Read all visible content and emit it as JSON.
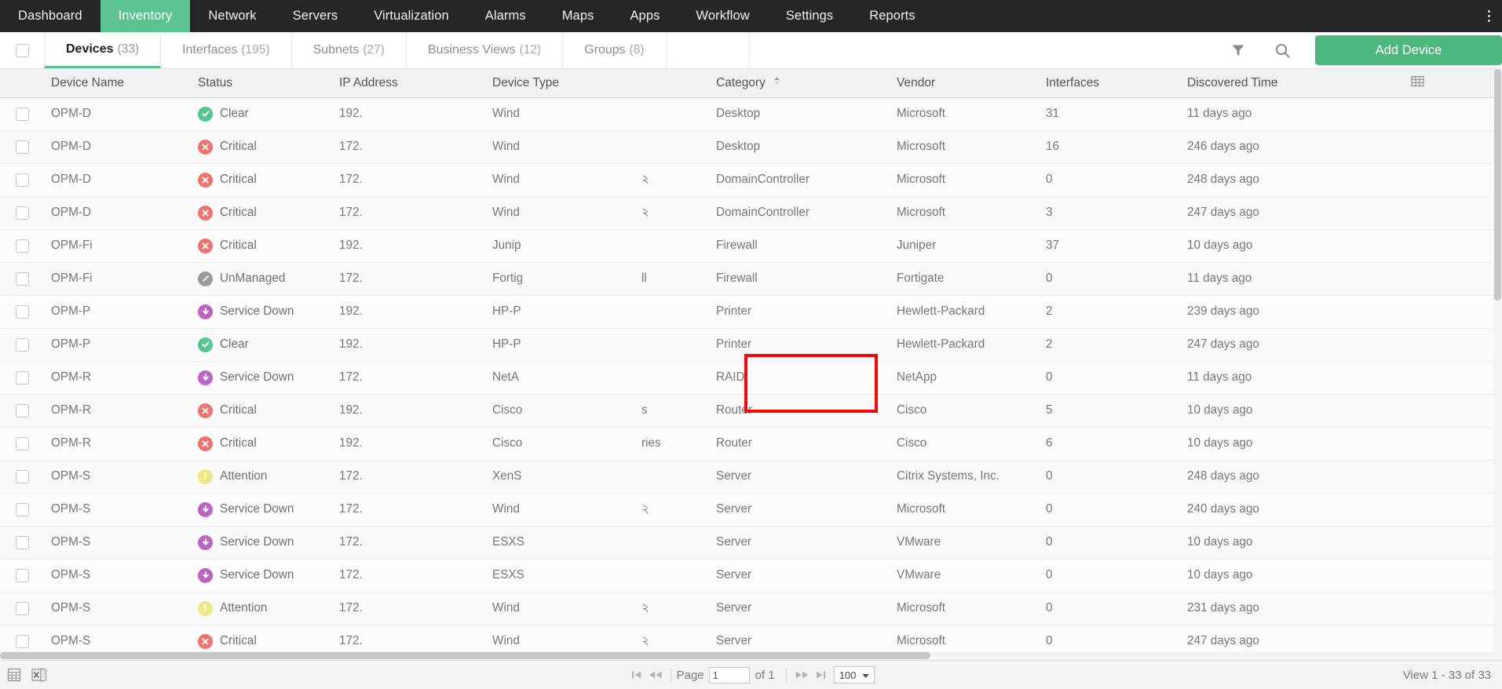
{
  "topnav": {
    "items": [
      {
        "label": "Dashboard",
        "active": false
      },
      {
        "label": "Inventory",
        "active": true
      },
      {
        "label": "Network",
        "active": false
      },
      {
        "label": "Servers",
        "active": false
      },
      {
        "label": "Virtualization",
        "active": false
      },
      {
        "label": "Alarms",
        "active": false
      },
      {
        "label": "Maps",
        "active": false
      },
      {
        "label": "Apps",
        "active": false
      },
      {
        "label": "Workflow",
        "active": false
      },
      {
        "label": "Settings",
        "active": false
      },
      {
        "label": "Reports",
        "active": false
      }
    ],
    "accent_active": "#5ac38f",
    "background": "#262626"
  },
  "tabbar": {
    "tabs": [
      {
        "label": "Devices",
        "count": "(33)",
        "active": true
      },
      {
        "label": "Interfaces",
        "count": "(195)",
        "active": false
      },
      {
        "label": "Subnets",
        "count": "(27)",
        "active": false
      },
      {
        "label": "Business Views",
        "count": "(12)",
        "active": false
      },
      {
        "label": "Groups",
        "count": "(8)",
        "active": false
      }
    ],
    "filter_icon": "filter-icon",
    "search_icon": "search-icon",
    "add_device_label": "Add Device",
    "add_device_color": "#4cb87e"
  },
  "table": {
    "columns": [
      {
        "key": "name",
        "label": "Device Name",
        "sorted": false
      },
      {
        "key": "stat",
        "label": "Status",
        "sorted": false
      },
      {
        "key": "ip",
        "label": "IP Address",
        "sorted": false
      },
      {
        "key": "type",
        "label": "Device Type",
        "sorted": false
      },
      {
        "key": "cat",
        "label": "Category",
        "sorted": true,
        "sort_dir": "asc"
      },
      {
        "key": "vend",
        "label": "Vendor",
        "sorted": false
      },
      {
        "key": "intf",
        "label": "Interfaces",
        "sorted": false
      },
      {
        "key": "disc",
        "label": "Discovered Time",
        "sorted": false
      }
    ],
    "column_chooser_icon": "grid-columns-icon",
    "rows": [
      {
        "name": "OPM-D",
        "status": "Clear",
        "status_icon": "clear-icon",
        "ip": "192.",
        "type": "Wind",
        "type2": "",
        "category": "Desktop",
        "vendor": "Microsoft",
        "interfaces": "31",
        "discovered": "11 days ago"
      },
      {
        "name": "OPM-D",
        "status": "Critical",
        "status_icon": "critical-icon",
        "ip": "172.",
        "type": "Wind",
        "type2": "",
        "category": "Desktop",
        "vendor": "Microsoft",
        "interfaces": "16",
        "discovered": "246 days ago"
      },
      {
        "name": "OPM-D",
        "status": "Critical",
        "status_icon": "critical-icon",
        "ip": "172.",
        "type": "Wind",
        "type2": "২",
        "category": "DomainController",
        "vendor": "Microsoft",
        "interfaces": "0",
        "discovered": "248 days ago"
      },
      {
        "name": "OPM-D",
        "status": "Critical",
        "status_icon": "critical-icon",
        "ip": "172.",
        "type": "Wind",
        "type2": "২",
        "category": "DomainController",
        "vendor": "Microsoft",
        "interfaces": "3",
        "discovered": "247 days ago"
      },
      {
        "name": "OPM-Fi",
        "status": "Critical",
        "status_icon": "critical-icon",
        "ip": "192.",
        "type": "Junip",
        "type2": "",
        "category": "Firewall",
        "vendor": "Juniper",
        "interfaces": "37",
        "discovered": "10 days ago"
      },
      {
        "name": "OPM-Fi",
        "status": "UnManaged",
        "status_icon": "unmanaged-icon",
        "ip": "172.",
        "type": "Fortig",
        "type2": "ll",
        "category": "Firewall",
        "vendor": "Fortigate",
        "interfaces": "0",
        "discovered": "11 days ago"
      },
      {
        "name": "OPM-P",
        "status": "Service Down",
        "status_icon": "service-down-icon",
        "ip": "192.",
        "type": "HP-P",
        "type2": "",
        "category": "Printer",
        "vendor": "Hewlett-Packard",
        "interfaces": "2",
        "discovered": "239 days ago"
      },
      {
        "name": "OPM-P",
        "status": "Clear",
        "status_icon": "clear-icon",
        "ip": "192.",
        "type": "HP-P",
        "type2": "",
        "category": "Printer",
        "vendor": "Hewlett-Packard",
        "interfaces": "2",
        "discovered": "247 days ago"
      },
      {
        "name": "OPM-R",
        "status": "Service Down",
        "status_icon": "service-down-icon",
        "ip": "172.",
        "type": "NetA",
        "type2": "",
        "category": "RAID",
        "vendor": "NetApp",
        "interfaces": "0",
        "discovered": "11 days ago"
      },
      {
        "name": "OPM-R",
        "status": "Critical",
        "status_icon": "critical-icon",
        "ip": "192.",
        "type": "Cisco",
        "type2": "s",
        "category": "Router",
        "vendor": "Cisco",
        "interfaces": "5",
        "discovered": "10 days ago"
      },
      {
        "name": "OPM-R",
        "status": "Critical",
        "status_icon": "critical-icon",
        "ip": "192.",
        "type": "Cisco",
        "type2": "ries",
        "category": "Router",
        "vendor": "Cisco",
        "interfaces": "6",
        "discovered": "10 days ago"
      },
      {
        "name": "OPM-S",
        "status": "Attention",
        "status_icon": "attention-icon",
        "ip": "172.",
        "type": "XenS",
        "type2": "",
        "category": "Server",
        "vendor": "Citrix Systems, Inc.",
        "interfaces": "0",
        "discovered": "248 days ago"
      },
      {
        "name": "OPM-S",
        "status": "Service Down",
        "status_icon": "service-down-icon",
        "ip": "172.",
        "type": "Wind",
        "type2": "২",
        "category": "Server",
        "vendor": "Microsoft",
        "interfaces": "0",
        "discovered": "240 days ago"
      },
      {
        "name": "OPM-S",
        "status": "Service Down",
        "status_icon": "service-down-icon",
        "ip": "172.",
        "type": "ESXS",
        "type2": "",
        "category": "Server",
        "vendor": "VMware",
        "interfaces": "0",
        "discovered": "10 days ago"
      },
      {
        "name": "OPM-S",
        "status": "Service Down",
        "status_icon": "service-down-icon",
        "ip": "172.",
        "type": "ESXS",
        "type2": "",
        "category": "Server",
        "vendor": "VMware",
        "interfaces": "0",
        "discovered": "10 days ago"
      },
      {
        "name": "OPM-S",
        "status": "Attention",
        "status_icon": "attention-icon",
        "ip": "172.",
        "type": "Wind",
        "type2": "২",
        "category": "Server",
        "vendor": "Microsoft",
        "interfaces": "0",
        "discovered": "231 days ago"
      },
      {
        "name": "OPM-S",
        "status": "Critical",
        "status_icon": "critical-icon",
        "ip": "172.",
        "type": "Wind",
        "type2": "২",
        "category": "Server",
        "vendor": "Microsoft",
        "interfaces": "0",
        "discovered": "247 days ago"
      }
    ],
    "annotation": {
      "shape": "rectangle",
      "color": "#fb0606",
      "highlights_cells": [
        "Printer",
        "Printer"
      ]
    },
    "status_colors": {
      "clear": "#53c78d",
      "critical": "#f0736f",
      "unmanaged": "#9b9b9b",
      "service_down": "#bb64c4",
      "attention": "#ecea84"
    }
  },
  "footer": {
    "export_pdf_icon": "export-grid-icon",
    "export_excel_icon": "export-excel-icon",
    "first_page_icon": "first-page-icon",
    "prev_page_icon": "prev-page-icon",
    "next_page_icon": "next-page-icon",
    "last_page_icon": "last-page-icon",
    "page_label": "Page",
    "page_value": "1",
    "of_label": "of 1",
    "page_size": "100",
    "view_range": "View 1 - 33 of 33"
  }
}
